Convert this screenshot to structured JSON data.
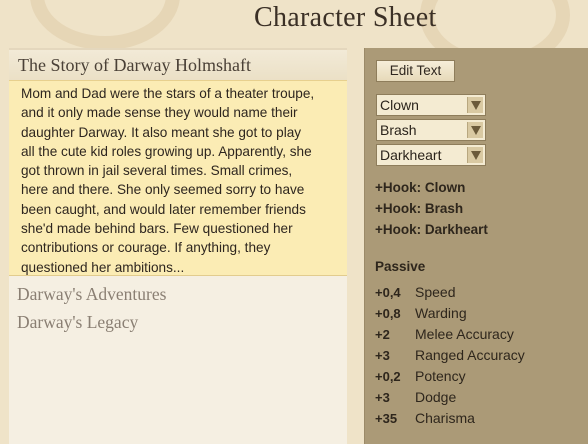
{
  "title": "Character Sheet",
  "story": {
    "header": "The Story of Darway Holmshaft",
    "lines": [
      "Mom and Dad were the stars of a theater troupe,",
      "and it only made sense they would name their",
      "daughter Darway. It also meant she got to play",
      "all the cute kid roles growing up.  Apparently, she",
      "got thrown in jail several times. Small crimes,",
      "here and there. She only seemed sorry to have",
      "been caught, and would later remember friends",
      "she'd made behind bars. Few questioned her",
      "contributions or courage. If anything, they",
      "questioned her ambitions..."
    ]
  },
  "sections": [
    "Darway's Adventures",
    "Darway's Legacy"
  ],
  "edit_button": "Edit Text",
  "dropdowns": [
    "Clown",
    "Brash",
    "Darkheart"
  ],
  "hooks": [
    "+Hook: Clown",
    "+Hook: Brash",
    "+Hook: Darkheart"
  ],
  "passive_title": "Passive",
  "stats": [
    {
      "value": "+0,4",
      "name": "Speed"
    },
    {
      "value": "+0,8",
      "name": "Warding"
    },
    {
      "value": "+2",
      "name": "Melee Accuracy"
    },
    {
      "value": "+3",
      "name": "Ranged Accuracy"
    },
    {
      "value": "+0,2",
      "name": "Potency"
    },
    {
      "value": "+3",
      "name": "Dodge"
    },
    {
      "value": "+35",
      "name": "Charisma"
    }
  ]
}
